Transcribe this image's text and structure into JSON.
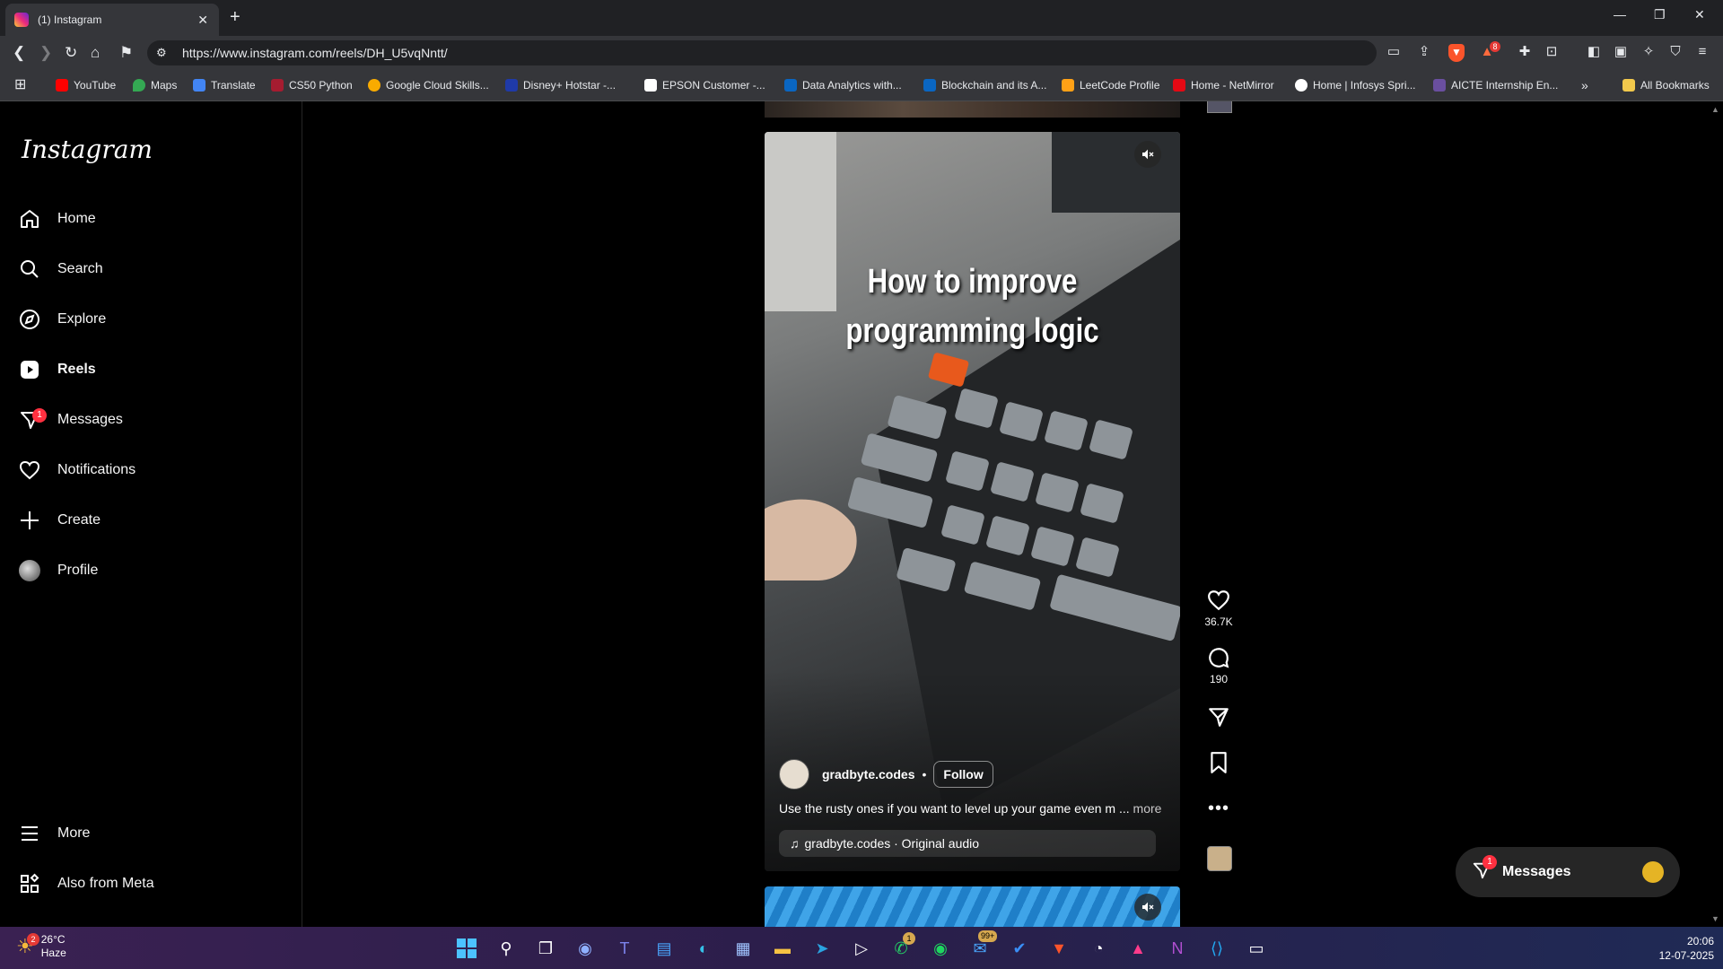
{
  "browser": {
    "tab_title": "(1) Instagram",
    "url": "https://www.instagram.com/reels/DH_U5vqNntt/",
    "bookmarks": [
      {
        "label": "YouTube",
        "color": "#ff0000"
      },
      {
        "label": "Maps",
        "color": "#34a853"
      },
      {
        "label": "Translate",
        "color": "#4285f4"
      },
      {
        "label": "CS50 Python",
        "color": "#a51c30"
      },
      {
        "label": "Google Cloud Skills...",
        "color": "#4285f4"
      },
      {
        "label": "Disney+ Hotstar -...",
        "color": "#1f3aa8"
      },
      {
        "label": "EPSON Customer -...",
        "color": "#ffffff"
      },
      {
        "label": "Data Analytics with...",
        "color": "#0a66c2"
      },
      {
        "label": "Blockchain and its A...",
        "color": "#0a66c2"
      },
      {
        "label": "LeetCode Profile",
        "color": "#ffa116"
      },
      {
        "label": "Home - NetMirror",
        "color": "#e50914"
      },
      {
        "label": "Home | Infosys Spri...",
        "color": "#ffffff"
      },
      {
        "label": "AICTE Internship En...",
        "color": "#6a4fa0"
      }
    ],
    "all_bookmarks": "All Bookmarks",
    "brave_badge": "8"
  },
  "instagram": {
    "logo": "Instagram",
    "nav": {
      "home": "Home",
      "search": "Search",
      "explore": "Explore",
      "reels": "Reels",
      "messages": "Messages",
      "messages_badge": "1",
      "notifications": "Notifications",
      "create": "Create",
      "profile": "Profile",
      "more": "More",
      "also_from_meta": "Also from Meta"
    },
    "reel": {
      "headline_line1": "How to improve",
      "headline_line2": "programming logic",
      "username": "gradbyte.codes",
      "separator": "•",
      "follow": "Follow",
      "caption": "Use the rusty ones if you want to level up your game even m ...",
      "caption_more": "more",
      "audio": "gradbyte.codes · Original audio",
      "likes": "36.7K",
      "comments": "190"
    },
    "messages_popup": {
      "label": "Messages",
      "badge": "1"
    }
  },
  "taskbar": {
    "temperature": "26°C",
    "condition": "Haze",
    "weather_badge": "2",
    "whatsapp_badge": "1",
    "mail_badge": "99+",
    "time": "20:06",
    "date": "12-07-2025"
  }
}
